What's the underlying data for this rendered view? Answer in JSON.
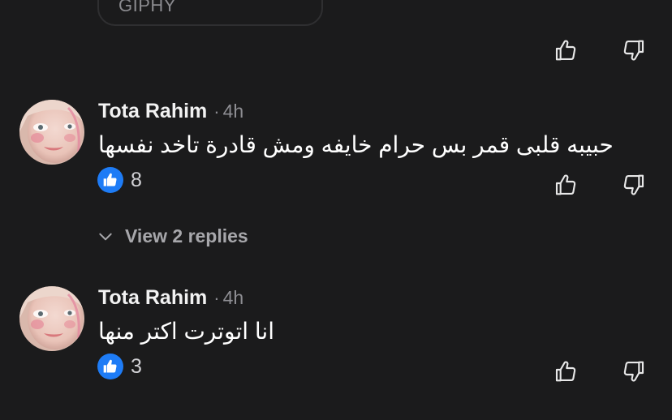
{
  "attachment": {
    "label": "GIPHY"
  },
  "comments": [
    {
      "author": "Tota Rahim",
      "separator": "·",
      "time": "4h",
      "text": "حبيبه قلبى قمر بس حرام خايفه ومش قادرة تاخد نفسها",
      "likes": "8",
      "replies_label": "View 2 replies"
    },
    {
      "author": "Tota Rahim",
      "separator": "·",
      "time": "4h",
      "text": "انا اتوترت اكتر منها",
      "likes": "3"
    }
  ],
  "icons": {
    "like": "thumbs-up-outline-icon",
    "dislike": "thumbs-down-outline-icon",
    "reaction": "like-reaction-icon",
    "expand": "chevron-down-icon"
  },
  "colors": {
    "background": "#1b1b1c",
    "accent": "#1e7cf6",
    "muted_text": "#8e8e93"
  }
}
